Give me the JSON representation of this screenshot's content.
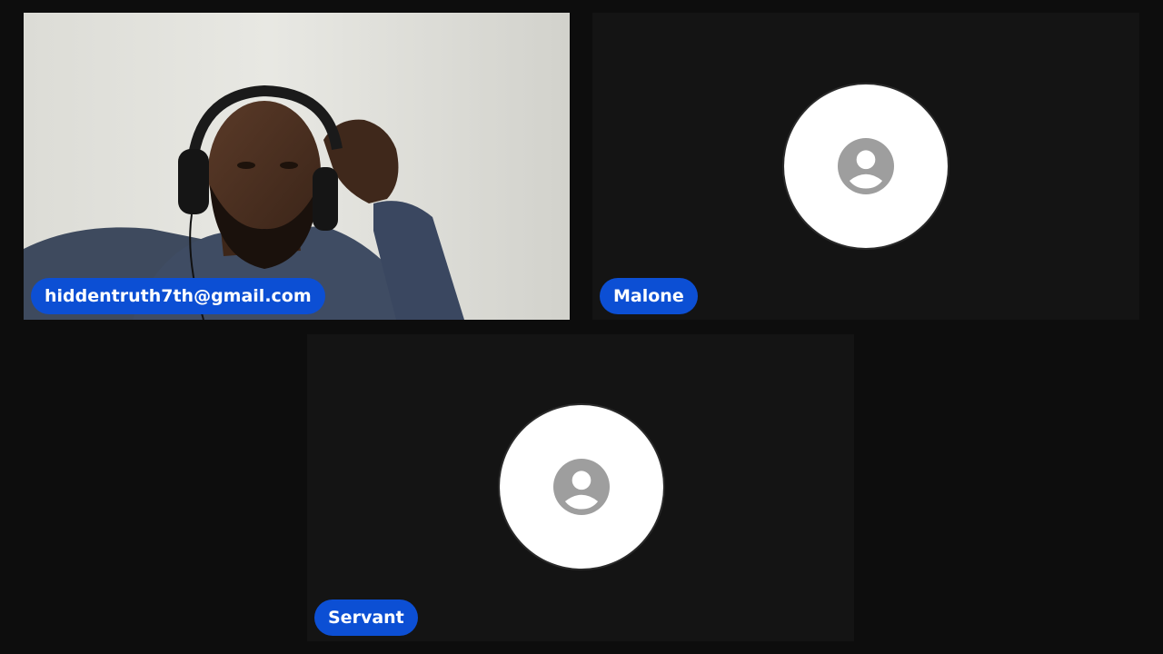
{
  "participants": [
    {
      "name": "hiddentruth7th@gmail.com",
      "has_video": true,
      "avatar_icon": "camera-feed"
    },
    {
      "name": "Malone",
      "has_video": false,
      "avatar_icon": "person-placeholder-icon"
    },
    {
      "name": "Servant",
      "has_video": false,
      "avatar_icon": "person-placeholder-icon"
    }
  ],
  "colors": {
    "name_tag_bg": "#0c4fd4",
    "tile_bg": "#141414",
    "page_bg": "#0d0d0d",
    "avatar_bg": "#ffffff",
    "avatar_icon": "#9e9e9e"
  }
}
